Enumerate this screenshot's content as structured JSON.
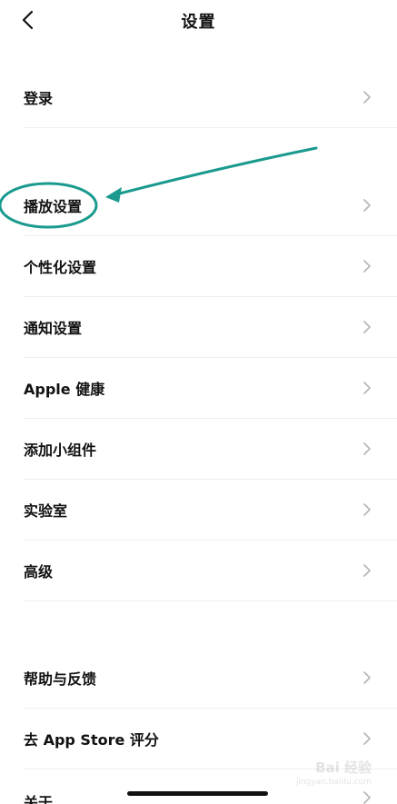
{
  "header": {
    "title": "设置",
    "back_icon": "chevron-left-icon"
  },
  "groups": [
    {
      "items": [
        {
          "label": "登录"
        }
      ]
    },
    {
      "items": [
        {
          "label": "播放设置"
        },
        {
          "label": "个性化设置"
        },
        {
          "label": "通知设置"
        },
        {
          "label": "Apple 健康"
        },
        {
          "label": "添加小组件"
        },
        {
          "label": "实验室"
        },
        {
          "label": "高级"
        }
      ]
    },
    {
      "items": [
        {
          "label": "帮助与反馈"
        },
        {
          "label": "去 App Store 评分"
        },
        {
          "label": "关于"
        }
      ]
    }
  ],
  "annotation": {
    "color": "#1a9a8e"
  },
  "watermark": {
    "brand": "Bai 经验",
    "url": "jingyan.baidu.com"
  },
  "colors": {
    "chevron": "#b8b8b8",
    "divider": "#eeeeee",
    "text": "#111111"
  }
}
